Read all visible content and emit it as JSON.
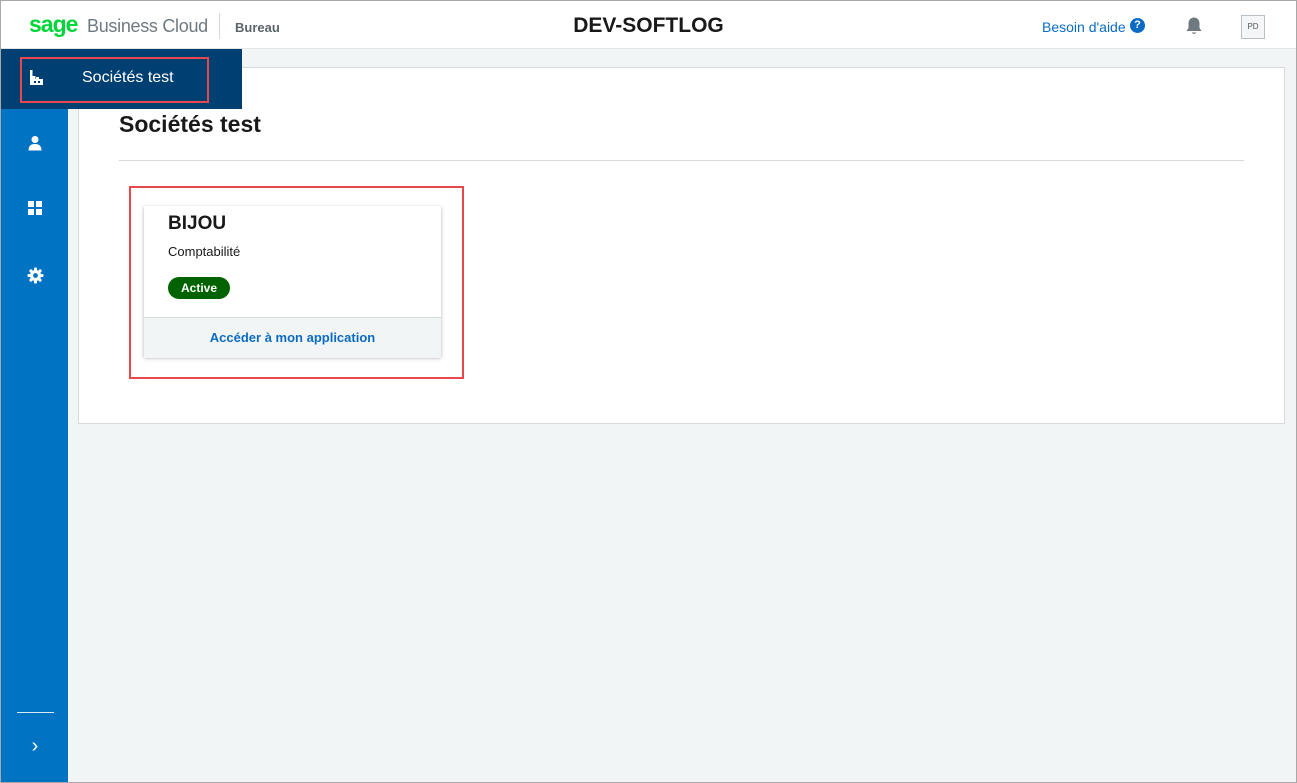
{
  "header": {
    "logo_brand": "sage",
    "logo_product": "Business Cloud",
    "section": "Bureau",
    "company": "DEV-SOFTLOG",
    "help_label": "Besoin d'aide",
    "help_icon_glyph": "?",
    "avatar_initials": "PD"
  },
  "sidebar": {
    "items": [
      {
        "icon": "company-test-icon"
      },
      {
        "icon": "user-icon"
      },
      {
        "icon": "grid-icon"
      },
      {
        "icon": "gear-icon"
      }
    ],
    "active_flyout_label": "Sociétés test",
    "expand_glyph": "›"
  },
  "main": {
    "title": "Sociétés test",
    "cards": [
      {
        "name": "BIJOU",
        "application": "Comptabilité",
        "status": "Active",
        "action": "Accéder à mon application"
      }
    ]
  },
  "colors": {
    "brand_green": "#00d639",
    "sidebar_blue": "#0073c2",
    "flyout_navy": "#003f72",
    "link_blue": "#0b6bc4",
    "active_green": "#006300",
    "highlight_red": "#e8474c"
  }
}
